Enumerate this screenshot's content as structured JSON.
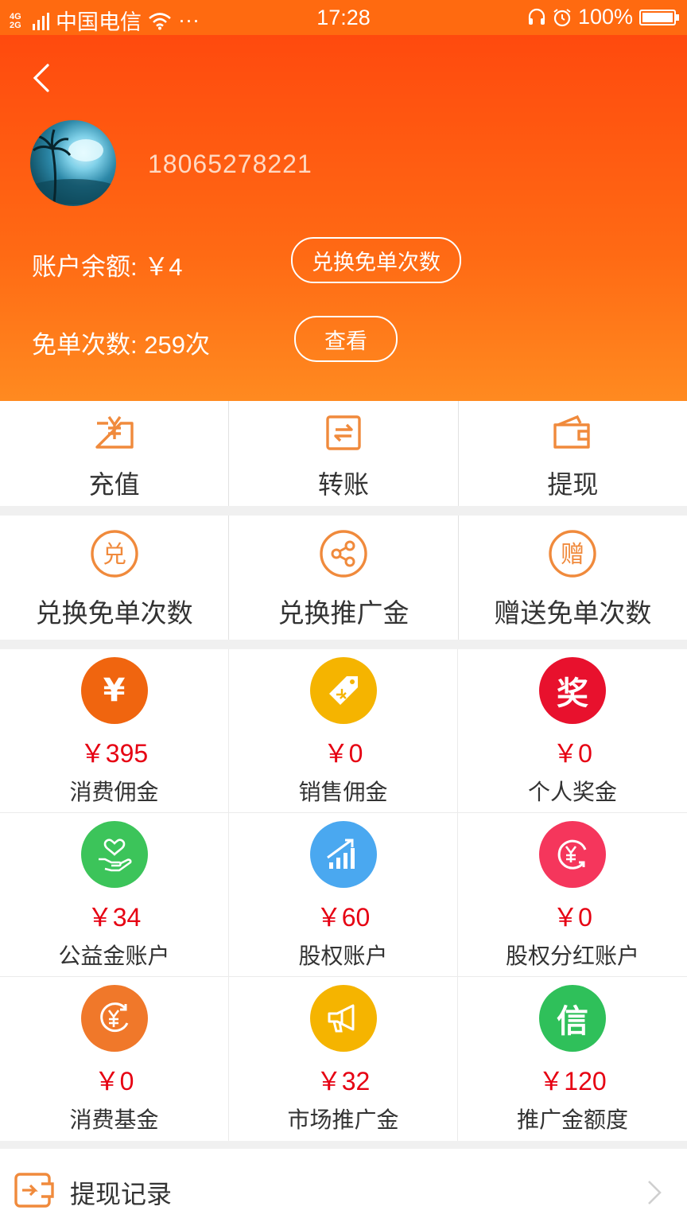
{
  "status_bar": {
    "network": "4G 2G",
    "carrier": "中国电信",
    "more": "···",
    "time": "17:28",
    "battery": "100%",
    "battery_level": 1.0
  },
  "header": {
    "phone": "18065278221",
    "balance_label": "账户余额: ￥4",
    "exchange_button": "兑换免单次数",
    "free_count_label": "免单次数: 259次",
    "view_button": "查看"
  },
  "actions": [
    {
      "label": "充值",
      "icon": "recharge-icon"
    },
    {
      "label": "转账",
      "icon": "transfer-icon"
    },
    {
      "label": "提现",
      "icon": "wallet-icon"
    }
  ],
  "exchange_actions": [
    {
      "label": "兑换免单次数",
      "icon": "exchange-icon"
    },
    {
      "label": "兑换推广金",
      "icon": "share-icon"
    },
    {
      "label": "赠送免单次数",
      "icon": "gift-icon"
    }
  ],
  "accounts": [
    {
      "amount": "￥395",
      "name": "消费佣金",
      "color": "#f0650f",
      "icon": "yuan-icon"
    },
    {
      "amount": "￥0",
      "name": "销售佣金",
      "color": "#f5b400",
      "icon": "price-tag-icon"
    },
    {
      "amount": "￥0",
      "name": "个人奖金",
      "color": "#e8112d",
      "icon": "award-icon"
    },
    {
      "amount": "￥34",
      "name": "公益金账户",
      "color": "#3cc45a",
      "icon": "charity-heart-icon"
    },
    {
      "amount": "￥60",
      "name": "股权账户",
      "color": "#4aa8f0",
      "icon": "growth-chart-icon"
    },
    {
      "amount": "￥0",
      "name": "股权分红账户",
      "color": "#f5365c",
      "icon": "dividend-icon"
    },
    {
      "amount": "￥0",
      "name": "消费基金",
      "color": "#f0782a",
      "icon": "fund-icon"
    },
    {
      "amount": "￥32",
      "name": "市场推广金",
      "color": "#f5b400",
      "icon": "megaphone-icon"
    },
    {
      "amount": "￥120",
      "name": "推广金额度",
      "color": "#2fc05a",
      "icon": "credit-icon"
    }
  ],
  "icon_glyphs": {
    "yuan": "¥",
    "award": "奖",
    "credit": "信",
    "exchange": "兑",
    "gift": "赠"
  },
  "record": {
    "label": "提现记录"
  },
  "colors": {
    "brand": "#ff5a12",
    "amount": "#e60012",
    "line_icon": "#f08a3c"
  }
}
